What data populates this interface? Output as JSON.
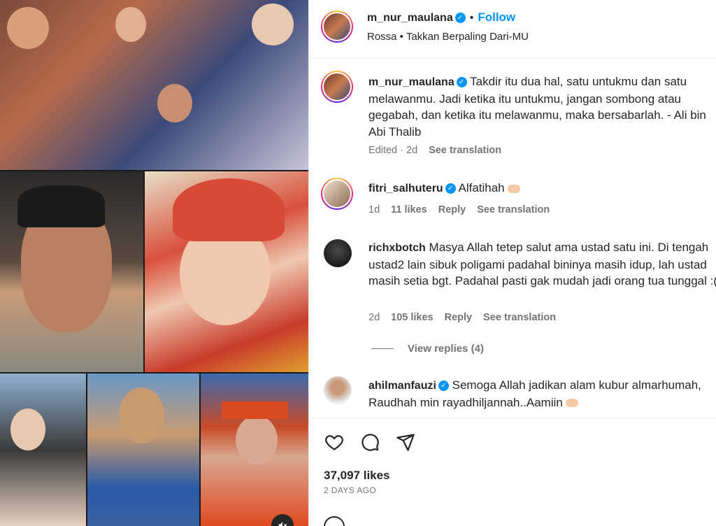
{
  "header": {
    "username": "m_nur_maulana",
    "follow_label": "Follow",
    "audio": "Rossa • Takkan Berpaling Dari-MU"
  },
  "caption": {
    "username": "m_nur_maulana",
    "text": "Takdir itu dua hal, satu untukmu dan satu melawanmu. Jadi ketika itu untukmu, jangan sombong atau gegabah, dan ketika itu melawanmu, maka bersabarlah. - Ali bin Abi Thalib",
    "edited": "Edited · 2d",
    "translate": "See translation"
  },
  "comments": [
    {
      "username": "fitri_salhuteru",
      "text": "Alfatihah",
      "time": "1d",
      "likes": "11 likes",
      "reply": "Reply",
      "translate": "See translation"
    },
    {
      "username": "richxbotch",
      "text": "Masya Allah tetep salut ama ustad satu ini. Di tengah ustad2 lain sibuk poligami padahal bininya masih idup, lah ustad masih setia bgt. Padahal pasti gak mudah jadi orang tua tunggal :(",
      "time": "2d",
      "likes": "105 likes",
      "reply": "Reply",
      "translate": "See translation",
      "view_replies": "View replies (4)"
    },
    {
      "username": "ahilmanfauzi",
      "text": "Semoga Allah jadikan alam kubur almarhumah, Raudhah min rayadhiljannah..Aamiin"
    }
  ],
  "actions": {
    "likes": "37,097 likes",
    "posted": "2 DAYS AGO"
  },
  "icons": {
    "verified": "verified-badge-icon",
    "like": "heart-icon",
    "comment": "comment-icon",
    "share": "share-icon",
    "mute": "mute-icon"
  },
  "colors": {
    "accent": "#0095f6",
    "text": "#262626",
    "muted": "#737373"
  }
}
